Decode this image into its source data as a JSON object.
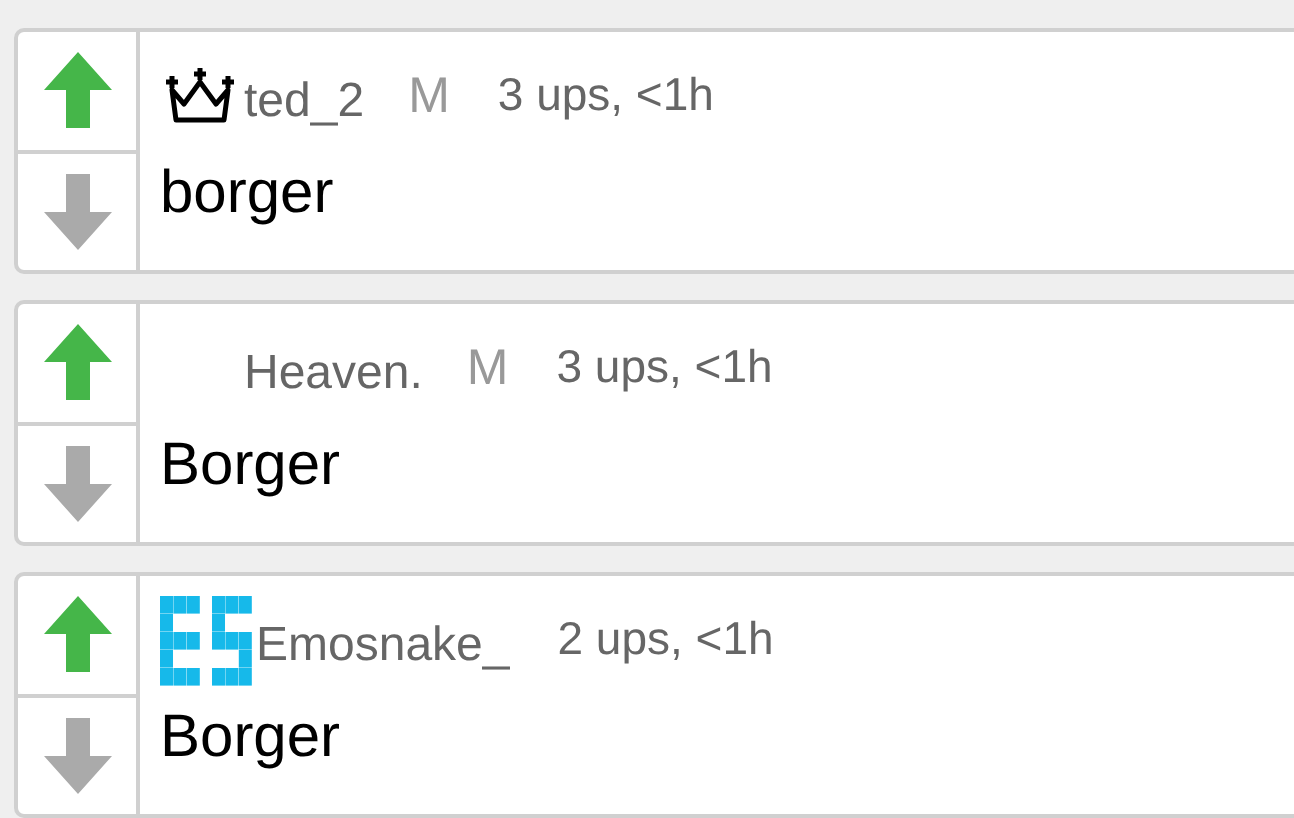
{
  "comments": [
    {
      "avatar": {
        "kind": "crown"
      },
      "username": "ted_2",
      "mod_badge": "M",
      "meta": "3 ups, <1h",
      "text": "borger",
      "upvoted": true,
      "downvoted": false
    },
    {
      "avatar": {
        "kind": "blank"
      },
      "username": "Heaven.",
      "mod_badge": "M",
      "meta": "3 ups, <1h",
      "text": "Borger",
      "upvoted": true,
      "downvoted": false
    },
    {
      "avatar": {
        "kind": "pixel"
      },
      "username": "Emosnake_",
      "meta": "2 ups, <1h",
      "text": "Borger",
      "upvoted": true,
      "downvoted": false
    }
  ]
}
